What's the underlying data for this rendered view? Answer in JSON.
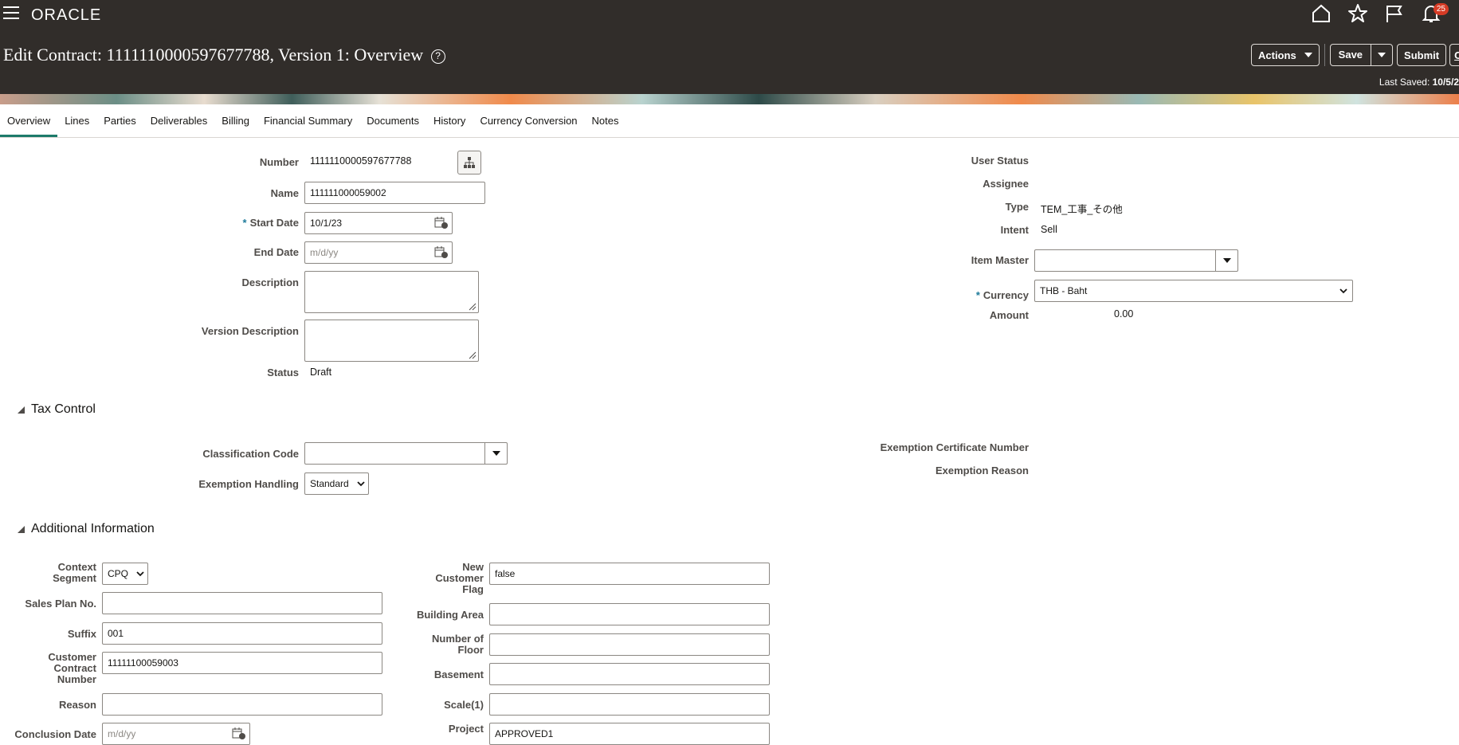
{
  "app": {
    "logo": "ORACLE",
    "notification_count": "25"
  },
  "header": {
    "title": "Edit Contract: 1111110000597677788, Version 1: Overview",
    "actions_label": "Actions",
    "save_label": "Save",
    "submit_label": "Submit",
    "cancel_label": "Ca",
    "last_saved_label": "Last Saved:",
    "last_saved_value": "10/5/2"
  },
  "tabs": [
    "Overview",
    "Lines",
    "Parties",
    "Deliverables",
    "Billing",
    "Financial Summary",
    "Documents",
    "History",
    "Currency Conversion",
    "Notes"
  ],
  "overview": {
    "number_label": "Number",
    "number_value": "1111110000597677788",
    "name_label": "Name",
    "name_value": "111111000059002",
    "start_date_label": "Start Date",
    "start_date_value": "10/1/23",
    "end_date_label": "End Date",
    "end_date_placeholder": "m/d/yy",
    "description_label": "Description",
    "version_description_label": "Version Description",
    "status_label": "Status",
    "status_value": "Draft",
    "user_status_label": "User Status",
    "assignee_label": "Assignee",
    "type_label": "Type",
    "type_value": "TEM_工事_その他",
    "intent_label": "Intent",
    "intent_value": "Sell",
    "item_master_label": "Item Master",
    "currency_label": "Currency",
    "currency_value": "THB - Baht",
    "amount_label": "Amount",
    "amount_value": "0.00"
  },
  "tax_control": {
    "title": "Tax Control",
    "classification_code_label": "Classification Code",
    "exemption_handling_label": "Exemption Handling",
    "exemption_handling_value": "Standard",
    "exemption_certificate_label": "Exemption Certificate Number",
    "exemption_reason_label": "Exemption Reason"
  },
  "additional_info": {
    "title": "Additional Information",
    "context_segment_label": "Context Segment",
    "context_segment_value": "CPQ",
    "sales_plan_label": "Sales Plan No.",
    "suffix_label": "Suffix",
    "suffix_value": "001",
    "customer_contract_label": "Customer Contract Number",
    "customer_contract_value": "11111100059003",
    "reason_label": "Reason",
    "conclusion_date_label": "Conclusion Date",
    "conclusion_date_placeholder": "m/d/yy",
    "new_customer_label": "New Customer Flag",
    "new_customer_value": "false",
    "building_area_label": "Building Area",
    "number_of_floor_label": "Number of Floor",
    "basement_label": "Basement",
    "scale_label": "Scale(1)",
    "project_label": "Project",
    "project_value": "APPROVED1"
  }
}
